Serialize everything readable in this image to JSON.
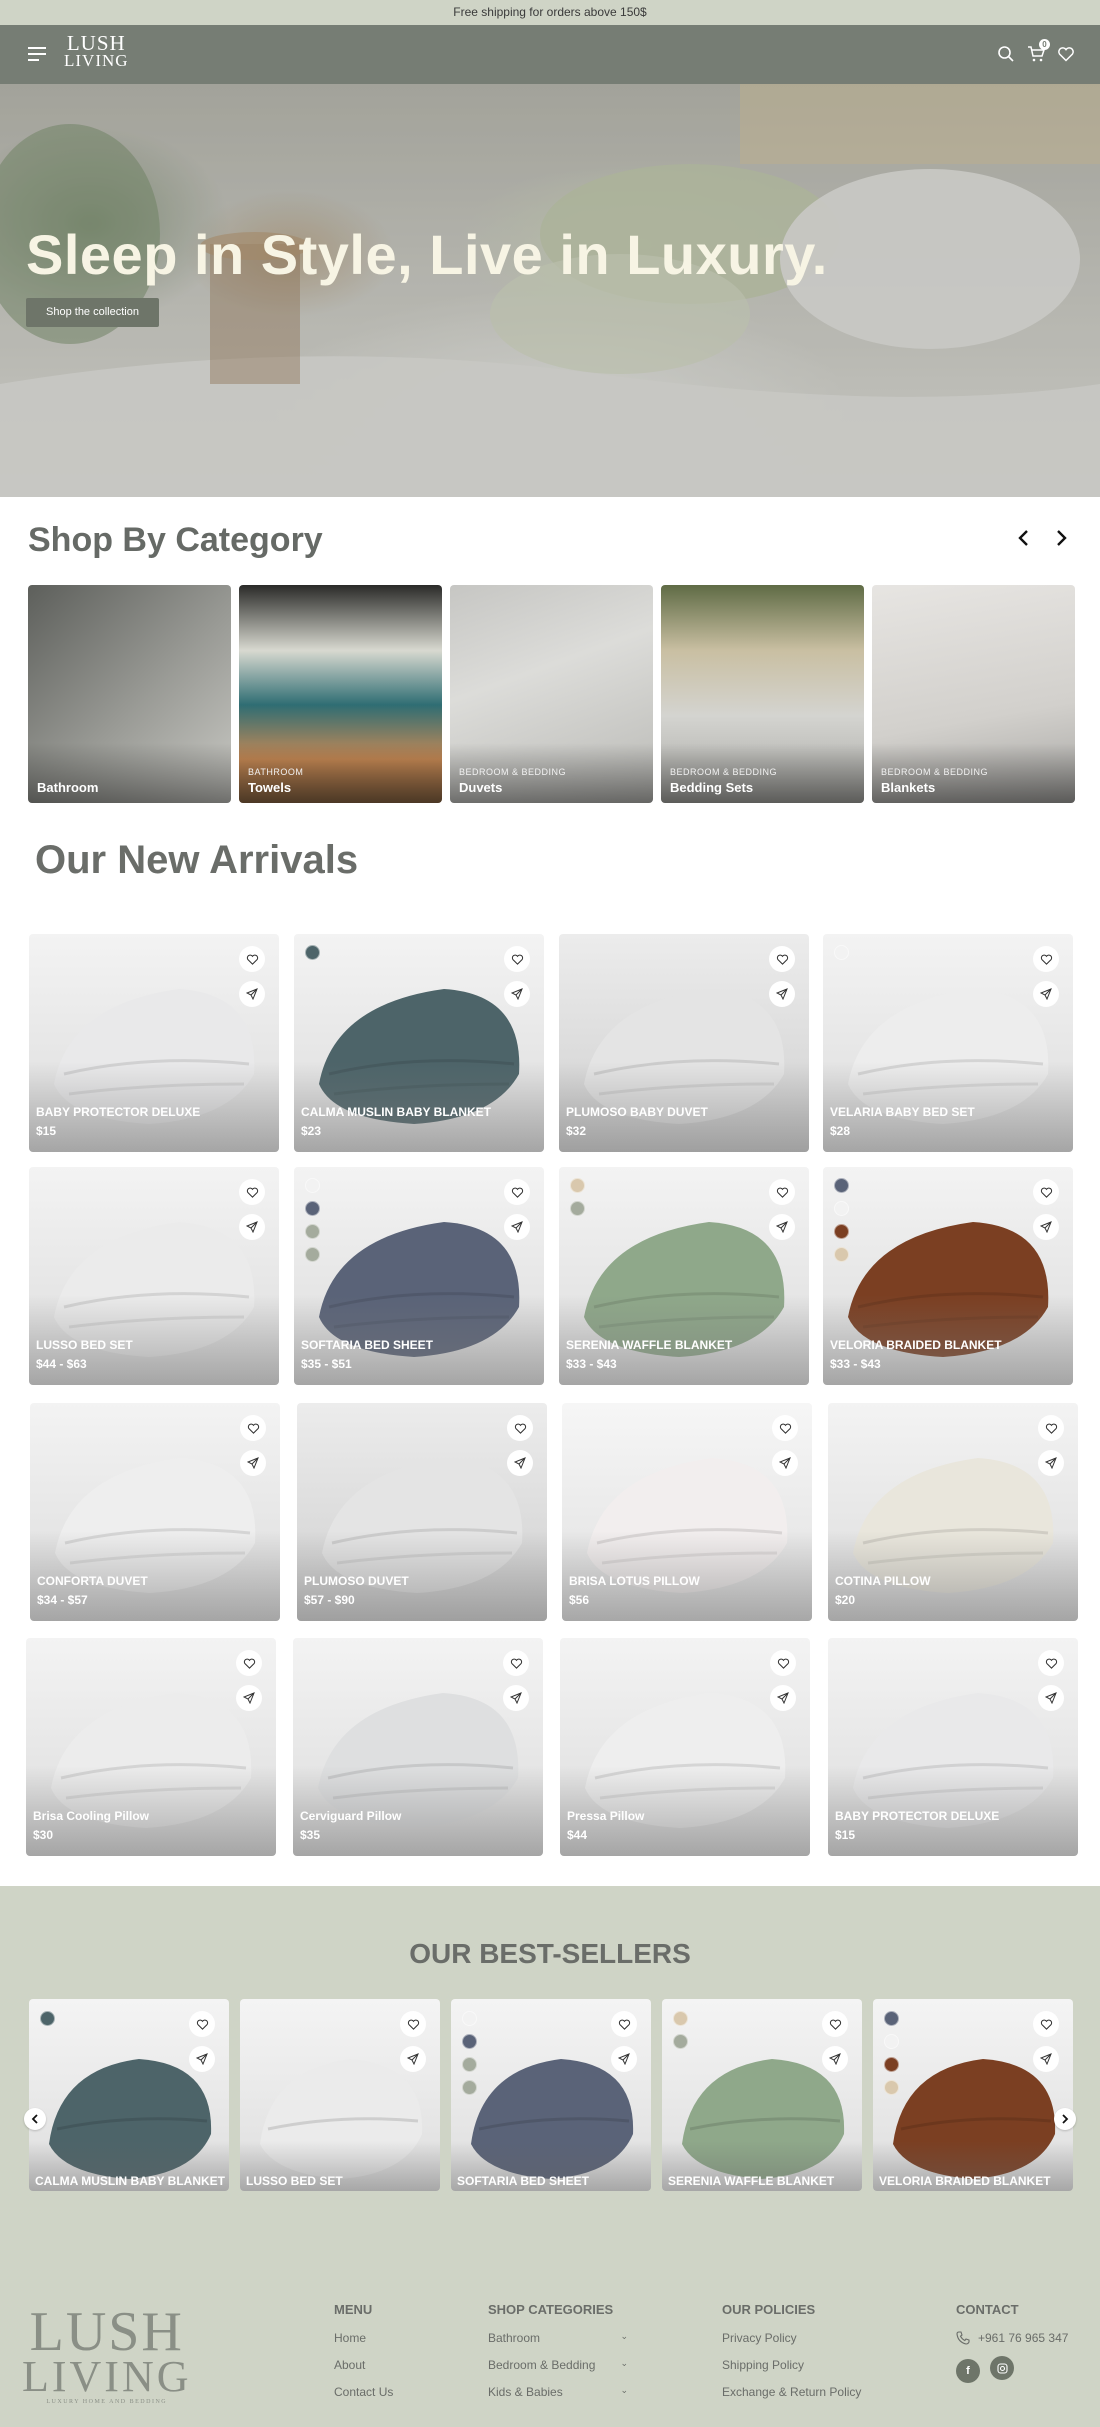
{
  "announcement": "Free shipping for orders above 150$",
  "logo": {
    "line1": "LUSH",
    "line2": "LIVING",
    "tagline": "LUXURY HOME AND BEDDING"
  },
  "header": {
    "cart_count": "0"
  },
  "hero": {
    "title": "Sleep in Style, Live in Luxury.",
    "button": "Shop the collection"
  },
  "categories": {
    "title": "Shop By Category",
    "items": [
      {
        "sub": "",
        "name": "Bathroom"
      },
      {
        "sub": "BATHROOM",
        "name": "Towels"
      },
      {
        "sub": "BEDROOM & BEDDING",
        "name": "Duvets"
      },
      {
        "sub": "BEDROOM & BEDDING",
        "name": "Bedding Sets"
      },
      {
        "sub": "BEDROOM & BEDDING",
        "name": "Blankets"
      }
    ]
  },
  "arrivals": {
    "title": "Our New Arrivals",
    "products": [
      {
        "name": "BABY PROTECTOR DELUXE",
        "price": "$15"
      },
      {
        "name": "CALMA MUSLIN BABY BLANKET",
        "price": "$23"
      },
      {
        "name": "PLUMOSO BABY DUVET",
        "price": "$32"
      },
      {
        "name": "VELARIA BABY BED SET",
        "price": "$28"
      },
      {
        "name": "LUSSO BED SET",
        "price": "$44 - $63"
      },
      {
        "name": "SOFTARIA BED SHEET",
        "price": "$35 - $51"
      },
      {
        "name": "SERENIA WAFFLE BLANKET",
        "price": "$33 - $43"
      },
      {
        "name": "VELORIA BRAIDED BLANKET",
        "price": "$33 - $43"
      },
      {
        "name": "CONFORTA DUVET",
        "price": "$34 - $57"
      },
      {
        "name": "PLUMOSO DUVET",
        "price": "$57 - $90"
      },
      {
        "name": "BRISA LOTUS PILLOW",
        "price": "$56"
      },
      {
        "name": "COTINA PILLOW",
        "price": "$20"
      },
      {
        "name": "Brisa Cooling Pillow",
        "price": "$30"
      },
      {
        "name": "Cerviguard Pillow",
        "price": "$35"
      },
      {
        "name": "Pressa Pillow",
        "price": "$44"
      },
      {
        "name": "BABY PROTECTOR DELUXE",
        "price": "$15"
      }
    ]
  },
  "bestsellers": {
    "title": "OUR BEST-SELLERS",
    "products": [
      {
        "name": "CALMA MUSLIN BABY BLANKET"
      },
      {
        "name": "LUSSO BED SET"
      },
      {
        "name": "SOFTARIA BED SHEET"
      },
      {
        "name": "SERENIA WAFFLE BLANKET"
      },
      {
        "name": "VELORIA BRAIDED BLANKET"
      }
    ]
  },
  "footer": {
    "menu": {
      "title": "MENU",
      "links": [
        "Home",
        "About",
        "Contact Us"
      ]
    },
    "shop": {
      "title": "SHOP CATEGORIES",
      "links": [
        "Bathroom",
        "Bedroom & Bedding",
        "Kids & Babies"
      ]
    },
    "policies": {
      "title": "OUR POLICIES",
      "links": [
        "Privacy Policy",
        "Shipping Policy",
        "Exchange & Return Policy"
      ]
    },
    "contact": {
      "title": "CONTACT",
      "phone": "+961 76 965 347",
      "social": [
        "f",
        "ig"
      ]
    }
  },
  "colors": {
    "nav": "#767d74",
    "announce_bg": "#cfd4c6",
    "swatch_teal": "#4d6469",
    "swatch_navy": "#5a6378",
    "swatch_sage": "#a4ab9d",
    "swatch_beige": "#d9c8ad",
    "swatch_brown": "#7b3f22",
    "swatch_white": "#f2f2f2"
  }
}
